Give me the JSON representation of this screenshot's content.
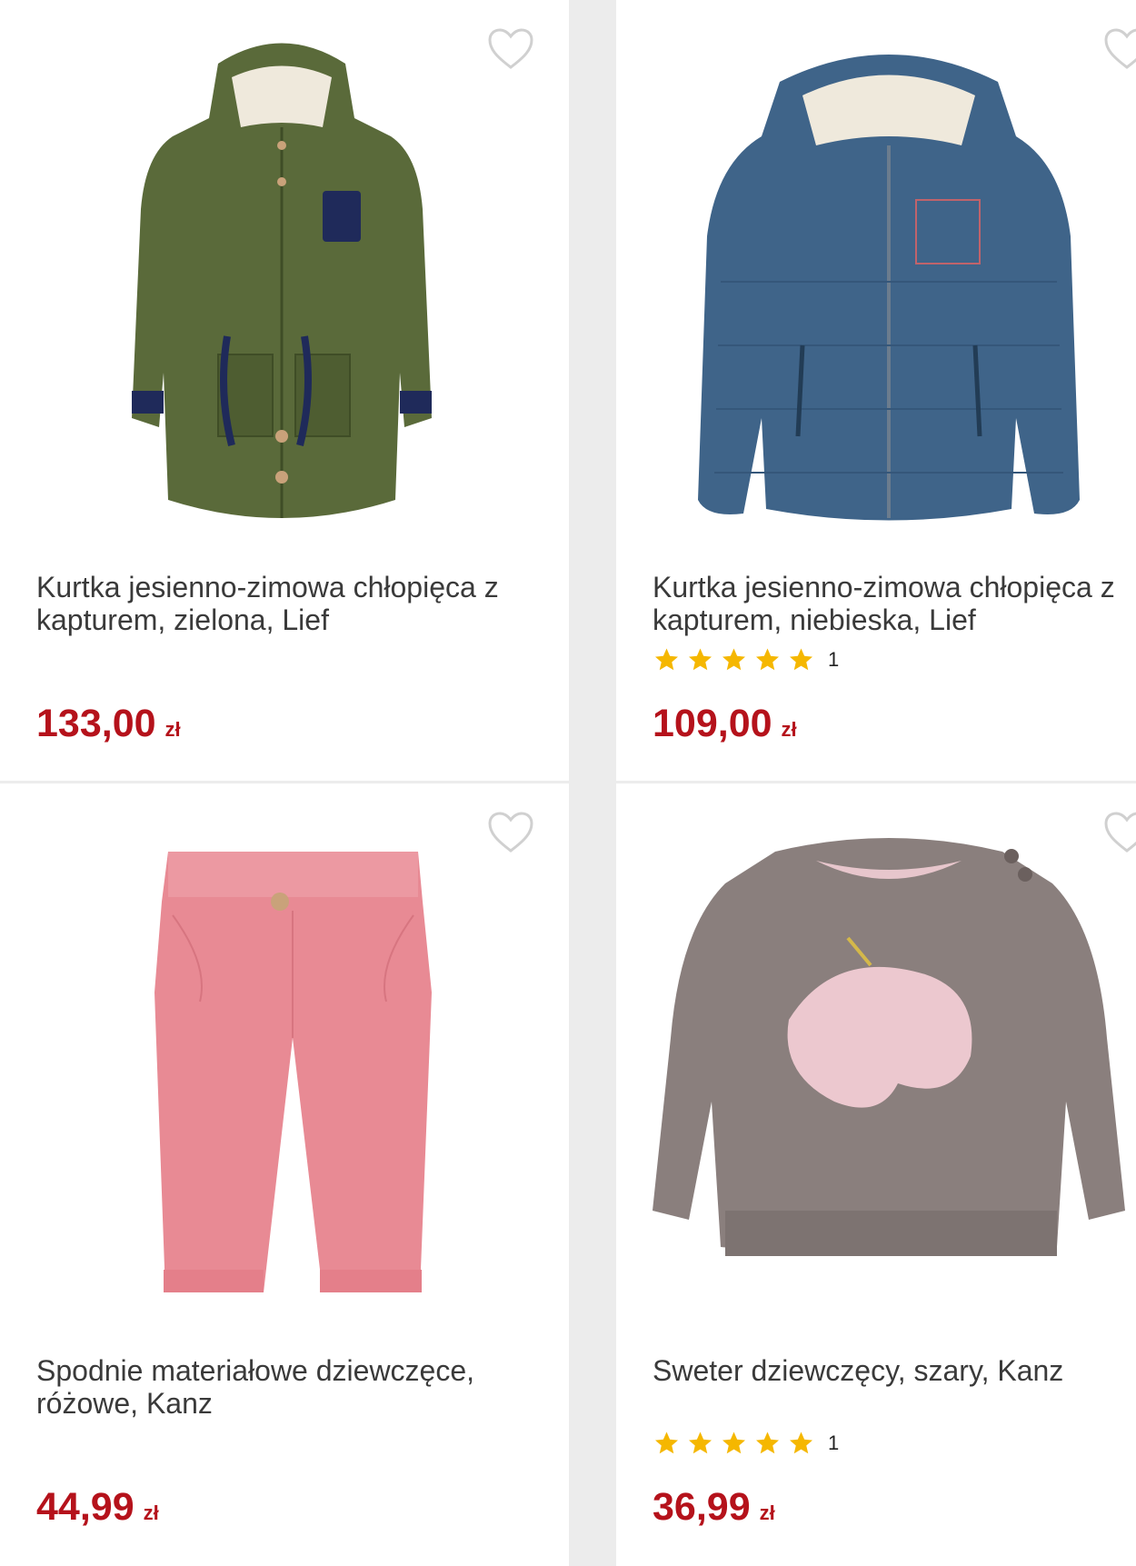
{
  "accent_color": "#b5121b",
  "star_color": "#f5b700",
  "products": [
    {
      "title": "Kurtka jesienno-zimowa chłopięca z kapturem, zielona, Lief",
      "price": "133,00",
      "currency": "zł",
      "image": "green-parka-jacket",
      "rating": null
    },
    {
      "title": "Kurtka jesienno-zimowa chłopięca z kapturem, niebieska, Lief",
      "price": "109,00",
      "currency": "zł",
      "image": "blue-puffer-jacket",
      "rating": {
        "stars": 5,
        "count": "1"
      }
    },
    {
      "title": "Spodnie materiałowe dziewczęce, różowe, Kanz",
      "price": "44,99",
      "currency": "zł",
      "image": "pink-corduroy-trousers",
      "rating": null
    },
    {
      "title": "Sweter dziewczęcy, szary, Kanz",
      "price": "36,99",
      "currency": "zł",
      "image": "grey-unicorn-sweater",
      "rating": {
        "stars": 5,
        "count": "1"
      }
    }
  ]
}
